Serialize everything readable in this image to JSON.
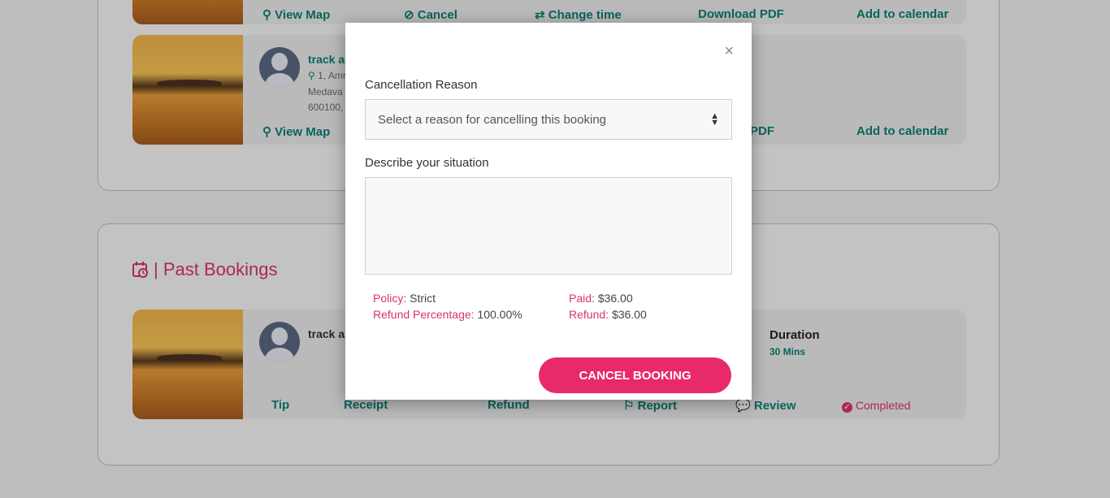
{
  "upcoming": {
    "row1_actions": {
      "view_map": "View Map",
      "cancel": "Cancel",
      "change_time": "Change time",
      "download_pdf": "Download PDF",
      "add_to_calendar": "Add to calendar"
    },
    "card2": {
      "title": "track a",
      "address_line1": "1, Amr",
      "address_line2": "Medava",
      "address_line3": "600100,",
      "view_map": "View Map",
      "pdf_partial": "PDF",
      "add_to_calendar": "Add to calendar"
    }
  },
  "past": {
    "section_title": "| Past Bookings",
    "card": {
      "title": "track a",
      "duration_label": "Duration",
      "duration_value": "30 Mins",
      "actions": {
        "tip": "Tip",
        "receipt": "Receipt",
        "refund": "Refund",
        "report": "Report",
        "review": "Review",
        "status": "Completed"
      }
    }
  },
  "modal": {
    "close_symbol": "×",
    "reason_label": "Cancellation Reason",
    "reason_placeholder": "Select a reason for cancelling this booking",
    "describe_label": "Describe your situation",
    "policy_label": "Policy:",
    "policy_value": "Strict",
    "refund_pct_label": "Refund Percentage:",
    "refund_pct_value": "100.00%",
    "paid_label": "Paid:",
    "paid_value": "$36.00",
    "refund_label": "Refund:",
    "refund_value": "$36.00",
    "cancel_button": "CANCEL BOOKING"
  },
  "colors": {
    "accent_pink": "#e8296b",
    "teal": "#0b7f73"
  }
}
